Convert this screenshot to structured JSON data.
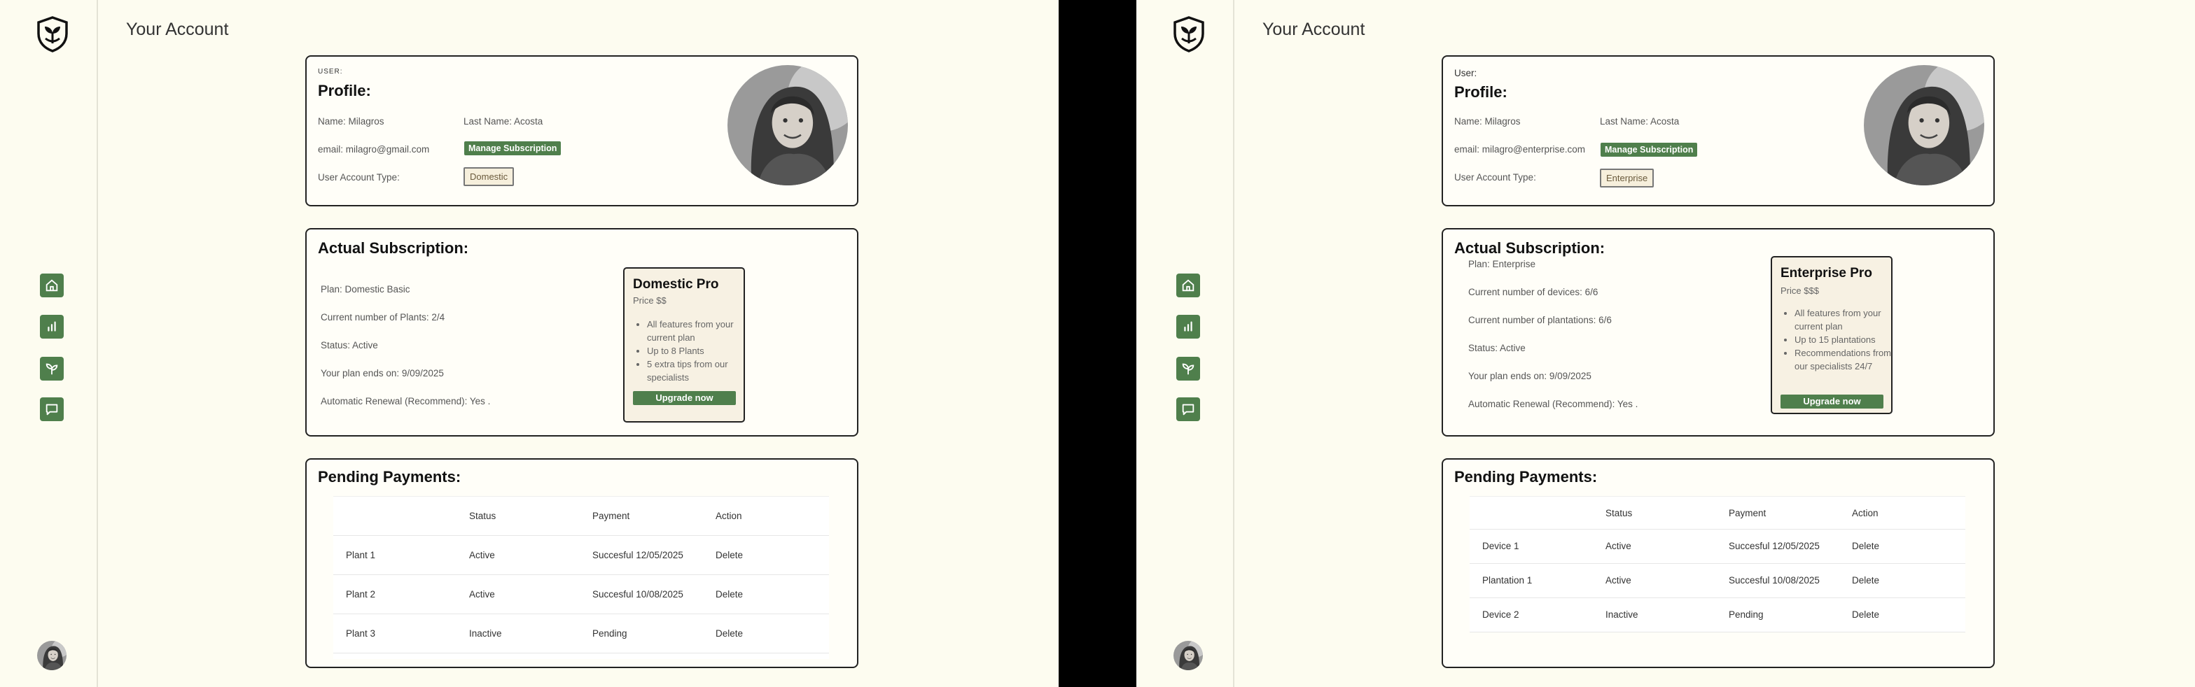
{
  "left": {
    "page_title": "Your Account",
    "profile": {
      "user_tag": "USER:",
      "heading": "Profile:",
      "name": "Name:  Milagros",
      "last_name": "Last Name:  Acosta",
      "email": "email: milagro@gmail.com",
      "manage_label": "Manage Subscription",
      "account_type_label": "User Account Type:",
      "account_type_value": "Domestic"
    },
    "subscription": {
      "heading": "Actual Subscription:",
      "lines": [
        "Plan: Domestic Basic",
        "Current number of Plants:  2/4",
        "Status: Active",
        "Your plan ends on: 9/09/2025",
        "Automatic Renewal (Recommend): Yes ."
      ],
      "plan_card": {
        "name": "Domestic Pro",
        "price": "Price $$",
        "features": [
          "All features from your current plan",
          "Up to 8 Plants",
          "5 extra tips from our specialists"
        ],
        "upgrade_label": "Upgrade now"
      }
    },
    "payments": {
      "heading": "Pending Payments:",
      "columns": [
        "",
        "Status",
        "Payment",
        "Action"
      ],
      "rows": [
        [
          "Plant 1",
          "Active",
          "Succesful 12/05/2025",
          "Delete"
        ],
        [
          "Plant 2",
          "Active",
          "Succesful 10/08/2025",
          "Delete"
        ],
        [
          "Plant 3",
          "Inactive",
          "Pending",
          "Delete"
        ]
      ]
    }
  },
  "right": {
    "page_title": "Your Account",
    "profile": {
      "user_tag": "User:",
      "heading": "Profile:",
      "name": "Name:  Milagros",
      "last_name": "Last Name:  Acosta",
      "email": "email: milagro@enterprise.com",
      "manage_label": "Manage Subscription",
      "account_type_label": "User Account Type:",
      "account_type_value": "Enterprise"
    },
    "subscription": {
      "heading": "Actual Subscription:",
      "lines": [
        "Plan: Enterprise",
        "Current number of devices:  6/6",
        "Current number of plantations: 6/6",
        "Status: Active",
        "Your plan ends on: 9/09/2025",
        "Automatic Renewal (Recommend): Yes ."
      ],
      "plan_card": {
        "name": "Enterprise Pro",
        "price": "Price $$$",
        "features": [
          "All features from your current plan",
          "Up to 15 plantations",
          "Recommendations from our specialists 24/7"
        ],
        "upgrade_label": "Upgrade now"
      }
    },
    "payments": {
      "heading": "Pending Payments:",
      "columns": [
        "",
        "Status",
        "Payment",
        "Action"
      ],
      "rows": [
        [
          "Device 1",
          "Active",
          "Succesful 12/05/2025",
          "Delete"
        ],
        [
          "Plantation 1",
          "Active",
          "Succesful 10/08/2025",
          "Delete"
        ],
        [
          "Device 2",
          "Inactive",
          "Pending",
          "Delete"
        ]
      ]
    }
  },
  "nav_icons": [
    "home-icon",
    "chart-icon",
    "plant-icon",
    "message-icon"
  ],
  "colors": {
    "accent": "#4f7f4c",
    "background": "#fdfcf0",
    "plan_card_bg": "#f7f1e3"
  }
}
